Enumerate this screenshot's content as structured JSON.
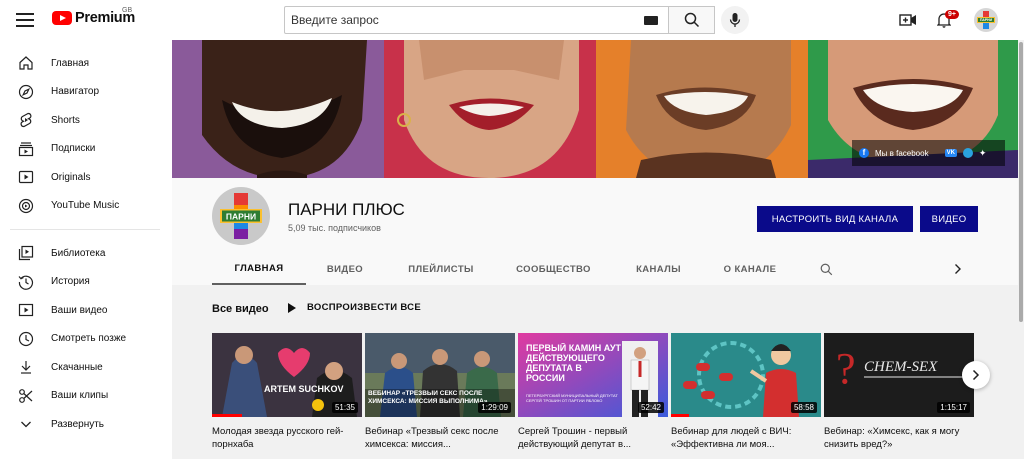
{
  "header": {
    "logo_text": "Premium",
    "region": "GB",
    "search_placeholder": "Введите запрос",
    "notifications_badge": "9+",
    "avatar_text": "ПАРНИ"
  },
  "sidebar": {
    "primary": [
      {
        "label": "Главная",
        "icon": "home-icon"
      },
      {
        "label": "Навигатор",
        "icon": "compass-icon"
      },
      {
        "label": "Shorts",
        "icon": "shorts-icon"
      },
      {
        "label": "Подписки",
        "icon": "subscriptions-icon"
      },
      {
        "label": "Originals",
        "icon": "originals-icon"
      },
      {
        "label": "YouTube Music",
        "icon": "music-icon"
      }
    ],
    "secondary": [
      {
        "label": "Библиотека",
        "icon": "library-icon"
      },
      {
        "label": "История",
        "icon": "history-icon"
      },
      {
        "label": "Ваши видео",
        "icon": "your-videos-icon"
      },
      {
        "label": "Смотреть позже",
        "icon": "watch-later-icon"
      },
      {
        "label": "Скачанные",
        "icon": "download-icon"
      },
      {
        "label": "Ваши клипы",
        "icon": "clips-icon"
      },
      {
        "label": "Развернуть",
        "icon": "chevron-down-icon"
      }
    ]
  },
  "banner": {
    "link_facebook": "Мы в facebook",
    "link_vk": "VK"
  },
  "channel": {
    "name": "ПАРНИ ПЛЮС",
    "subscribers": "5,09 тыс. подписчиков",
    "avatar_text": "ПАРНИ",
    "customize_button": "НАСТРОИТЬ ВИД КАНАЛА",
    "video_button": "ВИДЕО"
  },
  "tabs": [
    "ГЛАВНАЯ",
    "ВИДЕО",
    "ПЛЕЙЛИСТЫ",
    "СООБЩЕСТВО",
    "КАНАЛЫ",
    "О КАНАЛЕ"
  ],
  "section": {
    "title": "Все видео",
    "play_all": "ВОСПРОИЗВЕСТИ ВСЕ"
  },
  "videos": [
    {
      "title": "Молодая звезда русского гей-порнхаба",
      "duration": "51:35",
      "thumb_text": "ARTEM SUCHKOV",
      "progress": 0.2
    },
    {
      "title": "Вебинар «Трезвый секс после химсекса: миссия...",
      "duration": "1:29:09",
      "thumb_text": "ВЕБИНАР «ТРЕЗВЫЙ СЕКС ПОСЛЕ ХИМСЕКСА: МИССИЯ ВЫПОЛНИМА»",
      "progress": 0.0
    },
    {
      "title": "Сергей Трошин - первый действующий депутат в...",
      "duration": "52:42",
      "thumb_text": "ПЕРВЫЙ КАМИН АУТ ДЕЙСТВУЮЩЕГО ДЕПУТАТА В РОССИИ",
      "thumb_small": "ПЕТЕРБУРГСКИЙ МУНИЦИПАЛЬНЫЙ ДЕПУТАТ СЕРГЕЙ ТРОШИН ОТ ПАРТИИ ЯБЛОКО",
      "progress": 0.0
    },
    {
      "title": "Вебинар для людей с ВИЧ: «Эффективна ли моя...",
      "duration": "58:58",
      "thumb_text": "",
      "progress": 0.12
    },
    {
      "title": "Вебинар: «Химсекс, как я могу снизить вред?»",
      "duration": "1:15:17",
      "thumb_text": "CHEM-SEX",
      "progress": 0.0
    }
  ],
  "colors": {
    "brand_red": "#ff0000",
    "button_blue": "#0a0a8a",
    "banner_purple": "#8a5a9a",
    "banner_red": "#c8314a",
    "banner_orange": "#e5802a",
    "banner_green": "#2f9a4a"
  }
}
